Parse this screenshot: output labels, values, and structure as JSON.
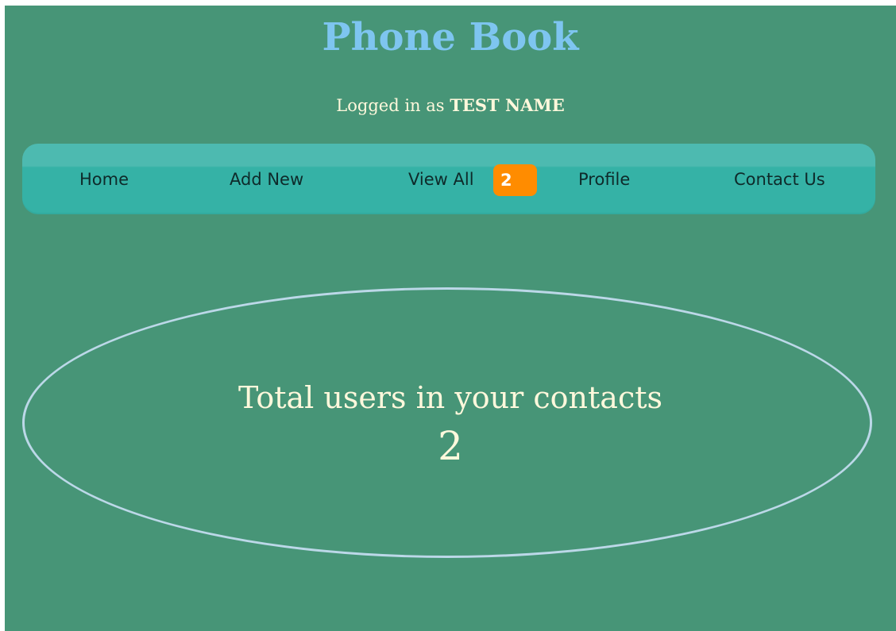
{
  "header": {
    "title": "Phone Book",
    "login_prefix": "Logged in as",
    "username": "TEST NAME"
  },
  "nav": {
    "home": "Home",
    "add_new": "Add New",
    "view_all": "View All",
    "view_all_count": "2",
    "profile": "Profile",
    "contact_us": "Contact Us"
  },
  "stats": {
    "label": "Total users in your contacts",
    "value": "2"
  },
  "colors": {
    "background": "#479577",
    "title": "#7ec5f0",
    "text": "#fff8dc",
    "navbar": "#35b2a6",
    "badge": "#ff8c00",
    "ellipse_border": "#bcd8e8"
  }
}
